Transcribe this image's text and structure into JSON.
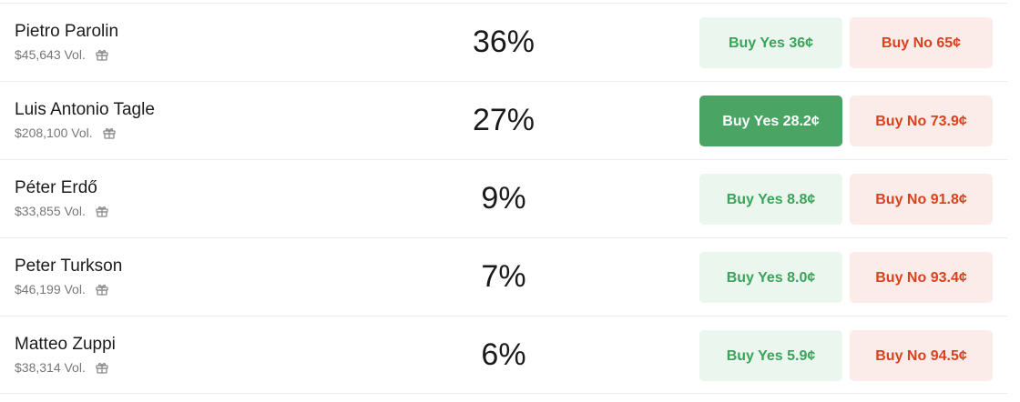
{
  "colors": {
    "yes_bg": "#eaf6ee",
    "yes_text": "#3ca35a",
    "yes_active_bg": "#4aa564",
    "no_bg": "#fcece9",
    "no_text": "#d9421f"
  },
  "icons": {
    "volume_reward": "gift-icon"
  },
  "candidates": [
    {
      "name": "Pietro Parolin",
      "volume": "$45,643 Vol.",
      "chance": "36%",
      "buy_yes": "Buy Yes 36¢",
      "buy_no": "Buy No 65¢",
      "yes_selected": false
    },
    {
      "name": "Luis Antonio Tagle",
      "volume": "$208,100 Vol.",
      "chance": "27%",
      "buy_yes": "Buy Yes 28.2¢",
      "buy_no": "Buy No 73.9¢",
      "yes_selected": true
    },
    {
      "name": "Péter Erdő",
      "volume": "$33,855 Vol.",
      "chance": "9%",
      "buy_yes": "Buy Yes 8.8¢",
      "buy_no": "Buy No 91.8¢",
      "yes_selected": false
    },
    {
      "name": "Peter Turkson",
      "volume": "$46,199 Vol.",
      "chance": "7%",
      "buy_yes": "Buy Yes 8.0¢",
      "buy_no": "Buy No 93.4¢",
      "yes_selected": false
    },
    {
      "name": "Matteo Zuppi",
      "volume": "$38,314 Vol.",
      "chance": "6%",
      "buy_yes": "Buy Yes 5.9¢",
      "buy_no": "Buy No 94.5¢",
      "yes_selected": false
    }
  ]
}
